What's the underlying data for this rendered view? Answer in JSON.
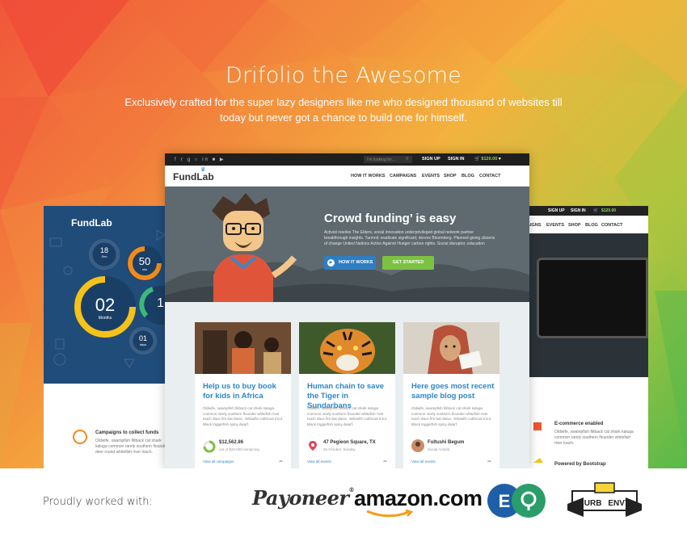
{
  "hero": {
    "title": "Drifolio the Awesome",
    "subtitle": "Exclusively crafted for the super lazy designers like me who designed thousand of websites till today but never got a chance to build one for himself."
  },
  "main_screen": {
    "topbar": {
      "search_placeholder": "I'm looking for...",
      "sign_up": "SIGN UP",
      "sign_in": "SIGN IN",
      "cart_amount": "$120.00"
    },
    "logo": "FundLab",
    "nav": [
      "HOW IT WORKS",
      "CAMPAIGNS",
      "EVENTS",
      "SHOP",
      "BLOG",
      "CONTACT"
    ],
    "banner": {
      "title": "Crowd funding’ is easy",
      "text": "Activist resolve The Elders, social innovation underprivileged global network partner breakthrough insights. Turmoil; eradicate significant; donors Bloomberg. Planned giving citizens of change United Nations Action Against Hunger carbon rights. Social disruptor; education",
      "how_button": "HOW IT WORKS",
      "start_button": "GET STARTED"
    },
    "cards": [
      {
        "title": "Help us to buy book for kids in Africa",
        "text": "Oldwife, swampfish fiitback cat shark kaluga common rarely southern flounder whitefish river loach dace fire bat danio. Yellowfin cutthroat trout Black triggerfish spiny dwarf.",
        "meta_main": "$12,562.86",
        "meta_sub": "out of $20,000 remaining",
        "footer": "View all campaigns"
      },
      {
        "title": "Human chain to save the Tiger in Sundarbans",
        "text": "Oldwife, swampfish fiitback cat shark kaluga common rarely southern flounder whitefish river loach dace fire bat danio. Yellowfin cutthroat trout Black triggerfish spiny dwarf.",
        "meta_main": "47 Pegieon Square, TX",
        "meta_sub": "25 October, Sunday",
        "footer": "View all events"
      },
      {
        "title": "Here goes most recent sample blog post",
        "text": "Oldwife, swampfish fiitback cat shark kaluga common rarely southern flounder whitefish river loach dace fire bat danio. Yellowfin cutthroat trout Black triggerfish spiny dwarf.",
        "meta_main": "Fultushi Begum",
        "meta_sub": "Social Activist",
        "footer": "View all events"
      }
    ]
  },
  "left_screen": {
    "logo": "FundLab",
    "countdown": [
      {
        "value": "18",
        "unit": "Sec"
      },
      {
        "value": "50",
        "unit": "min"
      },
      {
        "value": "02",
        "unit": "Months"
      },
      {
        "value": "1",
        "unit": ""
      },
      {
        "value": "01",
        "unit": "days"
      }
    ],
    "feature_title": "Campaigns to collect funds",
    "feature_text": "Oldwife, swampfish fiitback cat shark kaluga common rarely southern flounder deer round whitefish river loach."
  },
  "right_screen": {
    "topbar": {
      "sign_up": "SIGN UP",
      "sign_in": "SIGN IN",
      "cart_amount": "$120.00"
    },
    "nav": [
      "AIGNS",
      "EVENTS",
      "SHOP",
      "BLOG",
      "CONTACT"
    ],
    "features": [
      {
        "title": "E-commerce enabled",
        "text": "Oldwife, swampfish fiitback cat shark kaluga common rarely southern flounder whitefish river loach."
      },
      {
        "title": "Powered by Bootstrap",
        "text": ""
      }
    ]
  },
  "partners": {
    "label": "Proudly worked with:",
    "logos": [
      "Payoneer",
      "amazon.com",
      "EQ",
      "CURB ENVY"
    ],
    "payoneer_text": "Payoneer",
    "amazon_text": "amazon.com",
    "curb_text": "CURB",
    "envy_text": "ENVY"
  },
  "colors": {
    "accent_blue": "#2e86c8",
    "accent_green": "#7cc242",
    "countdown_orange": "#f08a1c",
    "countdown_yellow": "#f5c21b",
    "countdown_green": "#3cb878"
  }
}
